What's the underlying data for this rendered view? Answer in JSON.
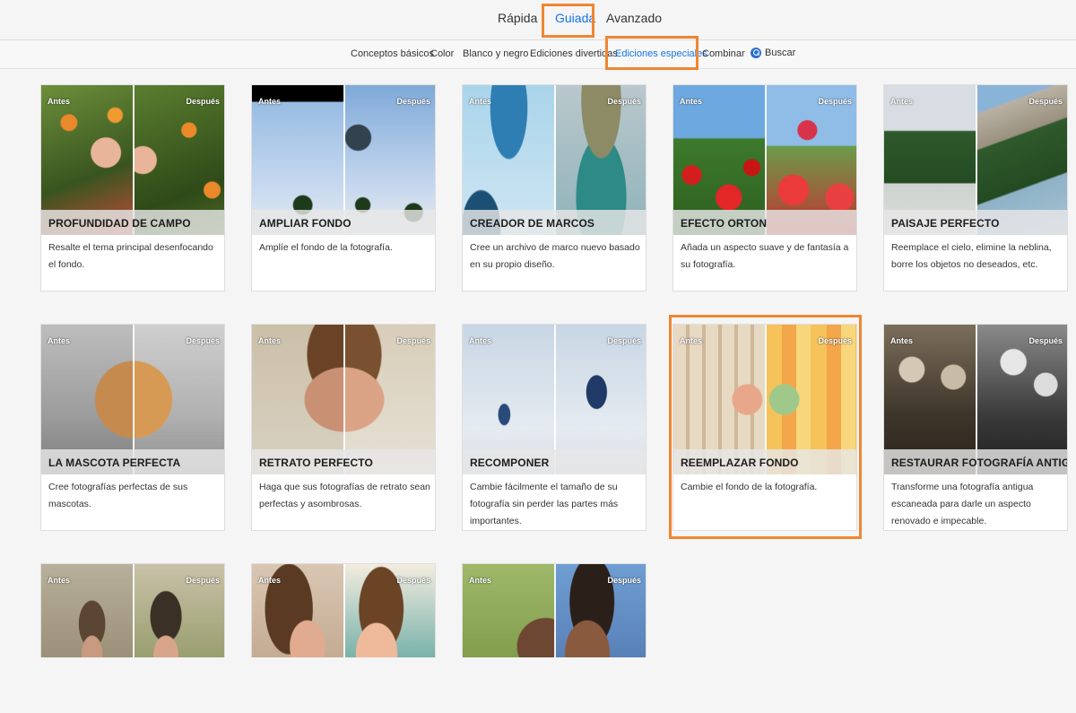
{
  "modes": [
    {
      "label": "Rápida",
      "active": false
    },
    {
      "label": "Guiada",
      "active": true
    },
    {
      "label": "Avanzado",
      "active": false
    }
  ],
  "categories": [
    {
      "label": "Conceptos básicos",
      "active": false
    },
    {
      "label": "Color",
      "active": false
    },
    {
      "label": "Blanco y negro",
      "active": false
    },
    {
      "label": "Ediciones divertidas",
      "active": false
    },
    {
      "label": "Ediciones especiales",
      "active": true
    },
    {
      "label": "Combinar",
      "active": false
    }
  ],
  "search": {
    "label": "Buscar",
    "icon": "search-icon"
  },
  "before_label": "Antes",
  "after_label": "Después",
  "highlight_color": "#ef8632",
  "accent_color": "#1473e6",
  "cards": [
    {
      "title": "PROFUNDIDAD DE CAMPO",
      "description": "Resalte el tema principal desenfocando el fondo."
    },
    {
      "title": "AMPLIAR FONDO",
      "description": "Amplíe el fondo de la fotografía."
    },
    {
      "title": "CREADOR DE MARCOS",
      "description": "Cree un archivo de marco nuevo basado en su propio diseño."
    },
    {
      "title": "EFECTO ORTON",
      "description": "Añada un aspecto suave y de fantasía a su fotografía."
    },
    {
      "title": "PAISAJE PERFECTO",
      "description": "Reemplace el cielo, elimine la neblina, borre los objetos no deseados, etc."
    },
    {
      "title": "LA MASCOTA PERFECTA",
      "description": "Cree fotografías perfectas de sus mascotas."
    },
    {
      "title": "RETRATO PERFECTO",
      "description": "Haga que sus fotografías de retrato sean perfectas y asombrosas."
    },
    {
      "title": "RECOMPONER",
      "description": "Cambie fácilmente el tamaño de su fotografía sin perder las partes más importantes."
    },
    {
      "title": "REEMPLAZAR FONDO",
      "description": "Cambie el fondo de la fotografía.",
      "highlighted": true
    },
    {
      "title": "RESTAURAR FOTOGRAFÍA ANTIGUA",
      "description": "Transforme una fotografía antigua escaneada para darle un aspecto renovado e impecable."
    }
  ]
}
